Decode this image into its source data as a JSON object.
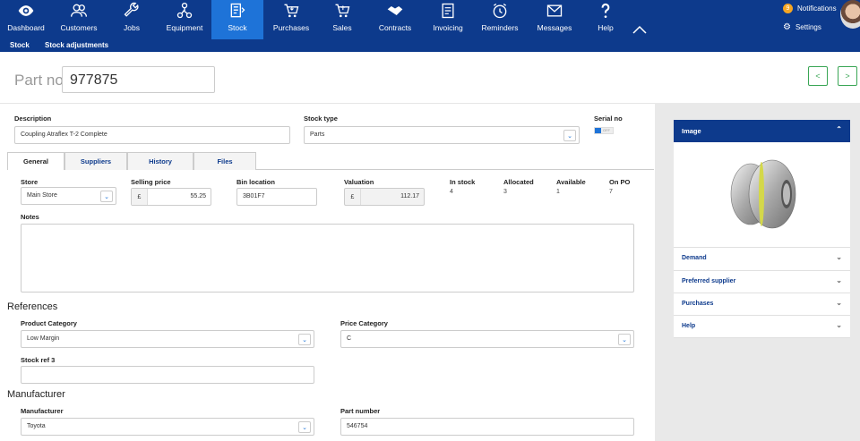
{
  "nav": [
    {
      "label": "Dashboard",
      "icon": "eye-icon"
    },
    {
      "label": "Customers",
      "icon": "users-icon"
    },
    {
      "label": "Jobs",
      "icon": "wrench-icon"
    },
    {
      "label": "Equipment",
      "icon": "network-icon"
    },
    {
      "label": "Stock",
      "icon": "stock-icon",
      "active": true
    },
    {
      "label": "Purchases",
      "icon": "cart-icon"
    },
    {
      "label": "Sales",
      "icon": "sales-cart-icon"
    },
    {
      "label": "Contracts",
      "icon": "handshake-icon"
    },
    {
      "label": "Invoicing",
      "icon": "invoice-icon"
    },
    {
      "label": "Reminders",
      "icon": "clock-icon"
    },
    {
      "label": "Messages",
      "icon": "envelope-icon"
    },
    {
      "label": "Help",
      "icon": "question-icon"
    }
  ],
  "subnav": [
    "Stock",
    "Stock adjustments"
  ],
  "user": {
    "notifications_label": "Notifications",
    "notifications_count": "9",
    "settings_label": "Settings"
  },
  "part": {
    "label": "Part no",
    "value": "977875"
  },
  "pager": {
    "prev": "<",
    "next": ">"
  },
  "form": {
    "description_label": "Description",
    "description_value": "Coupling Atraflex T-2 Complete",
    "stock_type_label": "Stock type",
    "stock_type_value": "Parts",
    "serial_label": "Serial no",
    "serial_toggle": "OFF"
  },
  "tabs": [
    "General",
    "Suppliers",
    "History",
    "Files"
  ],
  "general": {
    "store_label": "Store",
    "store_value": "Main Store",
    "selling_label": "Selling price",
    "currency": "£",
    "selling_value": "55.25",
    "bin_label": "Bin location",
    "bin_value": "3B01F7",
    "valuation_label": "Valuation",
    "valuation_value": "112.17",
    "in_stock_label": "In stock",
    "in_stock": "4",
    "allocated_label": "Allocated",
    "allocated": "3",
    "available_label": "Available",
    "available": "1",
    "onpo_label": "On PO",
    "onpo": "7",
    "notes_label": "Notes"
  },
  "references": {
    "heading": "References",
    "product_cat_label": "Product Category",
    "product_cat_value": "Low Margin",
    "price_cat_label": "Price Category",
    "price_cat_value": "C",
    "stockref_label": "Stock ref 3",
    "stockref_value": ""
  },
  "manufacturer": {
    "heading": "Manufacturer",
    "manu_label": "Manufacturer",
    "manu_value": "Toyota",
    "partnum_label": "Part number",
    "partnum_value": "546754"
  },
  "side": {
    "image_title": "Image",
    "rows": [
      "Demand",
      "Preferred supplier",
      "Purchases",
      "Help"
    ]
  }
}
